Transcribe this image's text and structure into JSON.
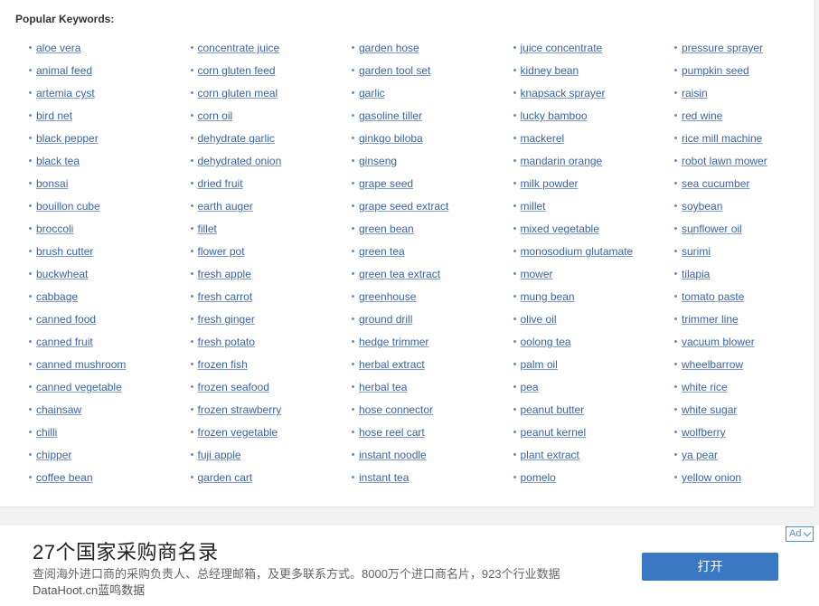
{
  "section": {
    "title": "Popular Keywords:"
  },
  "columns": [
    [
      "aloe vera",
      "animal feed",
      "artemia cyst",
      "bird net",
      "black pepper",
      "black tea",
      "bonsai",
      "bouillon cube",
      "broccoli",
      "brush cutter",
      "buckwheat",
      "cabbage",
      "canned food",
      "canned fruit",
      "canned mushroom",
      "canned vegetable",
      "chainsaw",
      "chilli",
      "chipper",
      "coffee bean"
    ],
    [
      "concentrate juice",
      "corn gluten feed",
      "corn gluten meal",
      "corn oil",
      "dehydrate garlic",
      "dehydrated onion",
      "dried fruit",
      "earth auger",
      "fillet",
      "flower pot",
      "fresh apple",
      "fresh carrot",
      "fresh ginger",
      "fresh potato",
      "frozen fish",
      "frozen seafood",
      "frozen strawberry",
      "frozen vegetable",
      "fuji apple",
      "garden cart"
    ],
    [
      "garden hose",
      "garden tool set",
      "garlic",
      "gasoline tiller",
      "ginkgo biloba",
      "ginseng",
      "grape seed",
      "grape seed extract",
      "green bean",
      "green tea",
      "green tea extract",
      "greenhouse",
      "ground drill",
      "hedge trimmer",
      "herbal extract",
      "herbal tea",
      "hose connector",
      "hose reel cart",
      "instant noodle",
      "instant tea"
    ],
    [
      "juice concentrate",
      "kidney bean",
      "knapsack sprayer",
      "lucky bamboo",
      "mackerel",
      "mandarin orange",
      "milk powder",
      "millet",
      "mixed vegetable",
      "monosodium glutamate",
      "mower",
      "mung bean",
      "olive oil",
      "oolong tea",
      "palm oil",
      "pea",
      "peanut butter",
      "peanut kernel",
      "plant extract",
      "pomelo"
    ],
    [
      "pressure sprayer",
      "pumpkin seed",
      "raisin",
      "red wine",
      "rice mill machine",
      "robot lawn mower",
      "sea cucumber",
      "soybean",
      "sunflower oil",
      "surimi",
      "tilapia",
      "tomato paste",
      "trimmer line",
      "vacuum blower",
      "wheelbarrow",
      "white rice",
      "white sugar",
      "wolfberry",
      "ya pear",
      "yellow onion"
    ]
  ],
  "ad": {
    "title": "27个国家采购商名录",
    "description": "查阅海外进口商的采购负责人、总经理邮箱，及更多联系方式。8000万个进口商名片，923个行业数据",
    "source": "DataHoot.cn蓝鸣数据",
    "button_label": "打开",
    "choice_label": "Ad"
  },
  "colors": {
    "link": "#3a64a8",
    "button": "#3a78c3",
    "background": "#f2f2f2"
  }
}
